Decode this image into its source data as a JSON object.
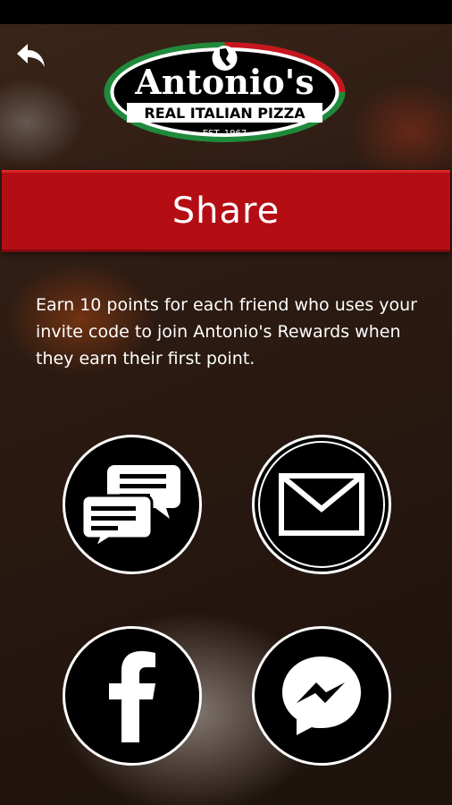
{
  "app": {
    "brand_name": "Antonio's",
    "brand_tagline": "REAL ITALIAN PIZZA",
    "brand_est": "EST. 1967"
  },
  "header": {
    "title": "Share"
  },
  "body": {
    "description": "Earn 10 points for each friend who uses your invite code to join Antonio's Rewards when they earn their first point."
  },
  "share_options": [
    {
      "icon": "sms-chat-icon"
    },
    {
      "icon": "email-envelope-icon"
    },
    {
      "icon": "facebook-icon"
    },
    {
      "icon": "messenger-icon"
    }
  ],
  "colors": {
    "accent_red": "#b50d14",
    "italy_green": "#1f8a3b",
    "text": "#ffffff"
  }
}
